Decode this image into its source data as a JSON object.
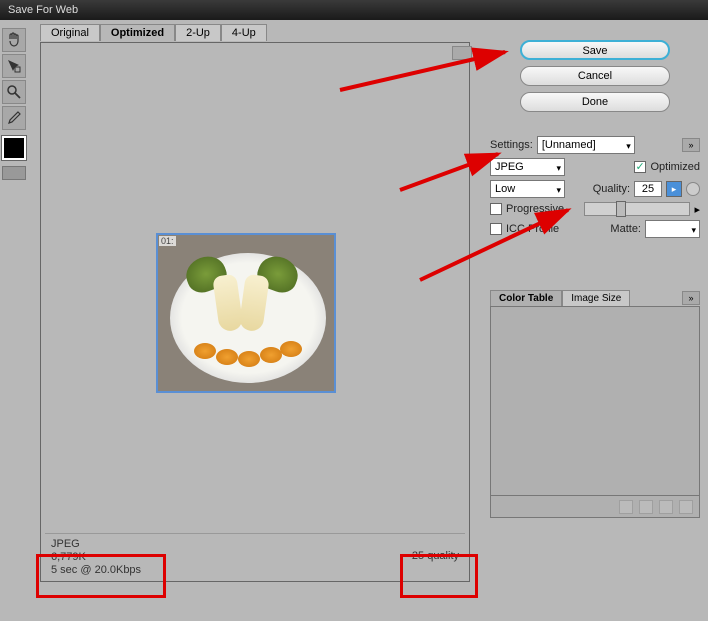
{
  "window": {
    "title": "Save For Web"
  },
  "tabs": {
    "items": [
      "Original",
      "Optimized",
      "2-Up",
      "4-Up"
    ],
    "active_index": 1
  },
  "preview": {
    "dim_label": "01:"
  },
  "status": {
    "format": "JPEG",
    "size": "6,779K",
    "time": "5 sec @ 20.0Kbps",
    "quality_text": "25 quality"
  },
  "buttons": {
    "save": "Save",
    "cancel": "Cancel",
    "done": "Done"
  },
  "settings": {
    "label": "Settings:",
    "preset": "[Unnamed]",
    "format": "JPEG",
    "optimized_label": "Optimized",
    "optimized_checked": true,
    "quality_preset": "Low",
    "quality_label": "Quality:",
    "quality_value": "25",
    "progressive_label": "Progressive",
    "progressive_checked": false,
    "icc_label": "ICC Profile",
    "icc_checked": false,
    "matte_label": "Matte:"
  },
  "sub_panel": {
    "tabs": [
      "Color Table",
      "Image Size"
    ],
    "active_index": 0
  }
}
